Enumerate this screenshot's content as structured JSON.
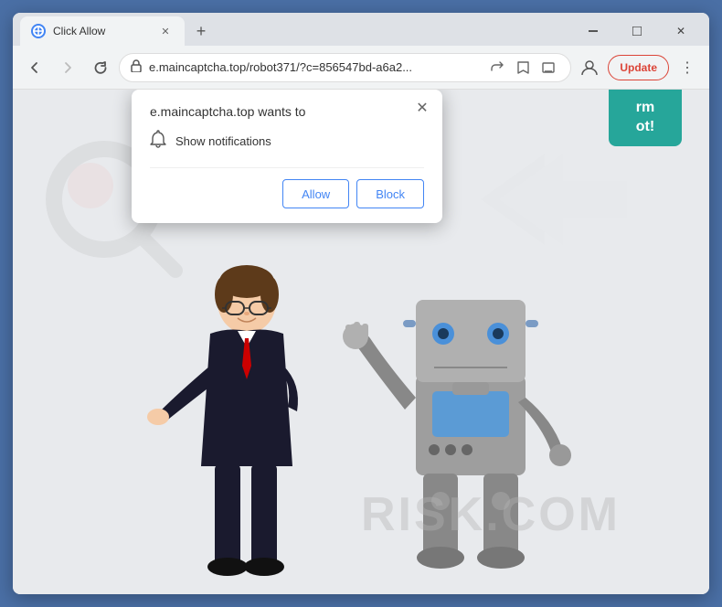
{
  "browser": {
    "tab": {
      "title": "Click Allow",
      "favicon": "●"
    },
    "nav": {
      "back_disabled": false,
      "forward_disabled": true,
      "address": "e.maincaptcha.top/robot371/?c=856547bd-a6a2...",
      "update_label": "Update"
    },
    "window": {
      "minimize": "─",
      "maximize": "□",
      "close": "✕"
    }
  },
  "popup": {
    "title": "e.maincaptcha.top wants to",
    "notification_label": "Show notifications",
    "allow_label": "Allow",
    "block_label": "Block",
    "close_symbol": "✕"
  },
  "page": {
    "captcha_line1": "rm",
    "captcha_line2": "ot!",
    "watermark": "RISK.COM"
  }
}
